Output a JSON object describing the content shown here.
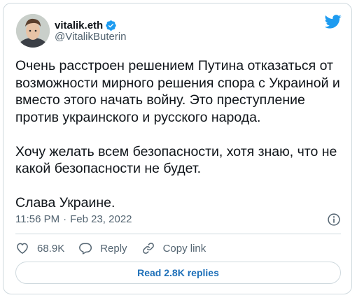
{
  "author": {
    "display_name": "vitalik.eth",
    "handle": "@VitalikButerin",
    "verified": true
  },
  "tweet": {
    "paragraphs": [
      "Очень расстроен решением Путина отказаться от возможности мирного решения спора с Украиной и вместо этого начать войну. Это преступление против украинского и русского народа.",
      "Хочу желать всем безопасности, хотя знаю, что не какой безопасности не будет.",
      "Слава Украине."
    ],
    "time": "11:56 PM",
    "separator": "·",
    "date": "Feb 23, 2022"
  },
  "actions": {
    "likes": "68.9K",
    "reply_label": "Reply",
    "copy_link_label": "Copy link"
  },
  "read_replies_label": "Read 2.8K replies",
  "icons": {
    "brand": "twitter-bird-icon",
    "verified": "verified-badge-icon",
    "info": "info-icon",
    "like": "heart-icon",
    "reply": "reply-bubble-icon",
    "copy_link": "link-icon"
  },
  "colors": {
    "brand_blue": "#1d9bf0",
    "link_blue": "#1d6fb8",
    "secondary_text": "#536471",
    "border": "#cfd9de"
  }
}
